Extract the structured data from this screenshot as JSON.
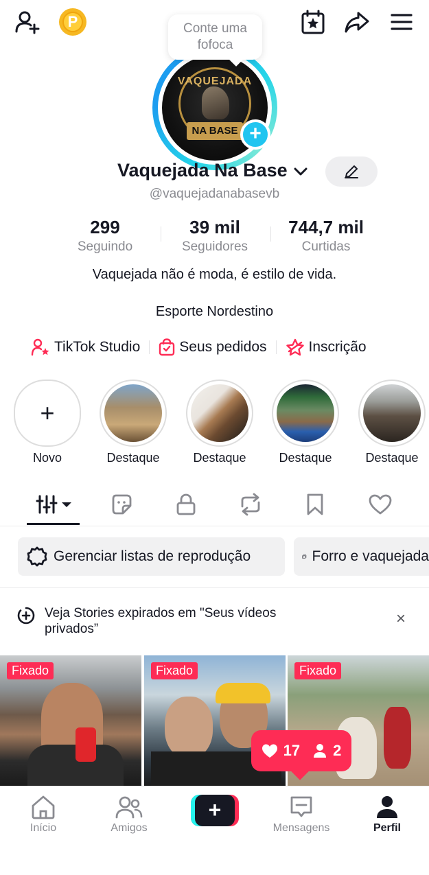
{
  "top_bar": {
    "add_friend_icon": "person-plus-icon",
    "coin_letter": "P",
    "calendar_icon": "calendar-star-icon",
    "share_icon": "share-arrow-icon",
    "menu_icon": "hamburger-menu-icon"
  },
  "avatar": {
    "bubble_text": "Conte uma fofoca",
    "logo_top": "VAQUEJADA",
    "logo_bottom": "NA BASE",
    "add_badge": "+"
  },
  "profile": {
    "name": "Vaquejada Na Base",
    "handle": "@vaquejadanabasevb"
  },
  "stats": [
    {
      "value": "299",
      "label": "Seguindo"
    },
    {
      "value": "39 mil",
      "label": "Seguidores"
    },
    {
      "value": "744,7 mil",
      "label": "Curtidas"
    }
  ],
  "bio": {
    "line1": "Vaquejada não é moda, é estilo de vida.",
    "line2": "Esporte Nordestino"
  },
  "links": [
    {
      "label": "TikTok Studio",
      "icon": "person-star-icon"
    },
    {
      "label": "Seus pedidos",
      "icon": "shopping-bag-icon"
    },
    {
      "label": "Inscrição",
      "icon": "subscription-star-icon"
    }
  ],
  "highlights": {
    "new_label": "Novo",
    "items": [
      {
        "label": "Destaque"
      },
      {
        "label": "Destaque"
      },
      {
        "label": "Destaque"
      },
      {
        "label": "Destaque"
      }
    ]
  },
  "tabs": [
    {
      "icon": "grid-filter-icon"
    },
    {
      "icon": "sticker-icon"
    },
    {
      "icon": "lock-icon"
    },
    {
      "icon": "repost-icon"
    },
    {
      "icon": "bookmark-icon"
    },
    {
      "icon": "heart-icon"
    }
  ],
  "chips": [
    {
      "label": "Gerenciar listas de reprodução",
      "icon": "gear-icon"
    },
    {
      "label": "Forro e vaquejada",
      "icon": "playlist-icon"
    }
  ],
  "notice": {
    "text": "Veja Stories expirados em \"Seus vídeos privados”",
    "close": "×"
  },
  "videos": [
    {
      "pinned_label": "Fixado"
    },
    {
      "pinned_label": "Fixado"
    },
    {
      "pinned_label": "Fixado"
    }
  ],
  "engagement_popup": {
    "likes": "17",
    "followers": "2"
  },
  "bottom_nav": [
    {
      "label": "Início",
      "icon": "home-icon"
    },
    {
      "label": "Amigos",
      "icon": "friends-icon"
    },
    {
      "label": "",
      "icon": "create-plus-icon"
    },
    {
      "label": "Mensagens",
      "icon": "message-icon"
    },
    {
      "label": "Perfil",
      "icon": "profile-icon"
    }
  ],
  "colors": {
    "accent": "#fe2c55",
    "cyan": "#25f4ee",
    "text": "#161823",
    "muted": "#8a8b91"
  }
}
